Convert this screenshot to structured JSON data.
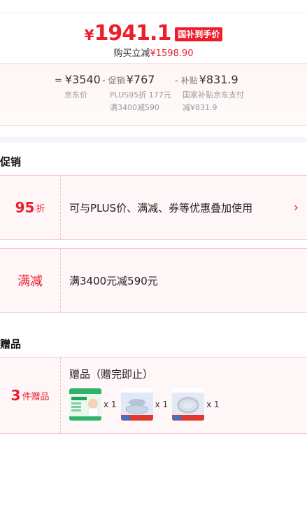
{
  "hero": {
    "yen": "¥",
    "price": "1941.1",
    "badge": "国补到手价",
    "buy_reduce_prefix": "购买立减",
    "buy_reduce_value": "¥1598.90"
  },
  "breakdown": [
    {
      "op": "=",
      "tag": "",
      "value": "¥3540",
      "sub1": "京东价",
      "sub2": ""
    },
    {
      "op": "-",
      "tag": "促销",
      "value": "¥767",
      "sub1": "PLUS95折 177元",
      "sub2": "满3400减590"
    },
    {
      "op": "-",
      "tag": "补贴",
      "value": "¥831.9",
      "sub1": "国家补贴京东支付",
      "sub2": "减¥831.9"
    }
  ],
  "promo": {
    "title": "促销",
    "discount_num": "95",
    "discount_unit": "折",
    "discount_desc": "可与PLUS价、满减、券等优惠叠加使用",
    "manjian_label": "满减",
    "manjian_desc": "满3400元减590元"
  },
  "gift": {
    "title": "赠品",
    "count_num": "3",
    "count_label": "件赠品",
    "heading": "赠品（赠完即止）",
    "items": [
      {
        "qty": "x 1"
      },
      {
        "qty": "x 1"
      },
      {
        "qty": "x 1"
      }
    ]
  },
  "colors": {
    "accent": "#ee1d2b",
    "card_bg": "#fff6f7"
  }
}
